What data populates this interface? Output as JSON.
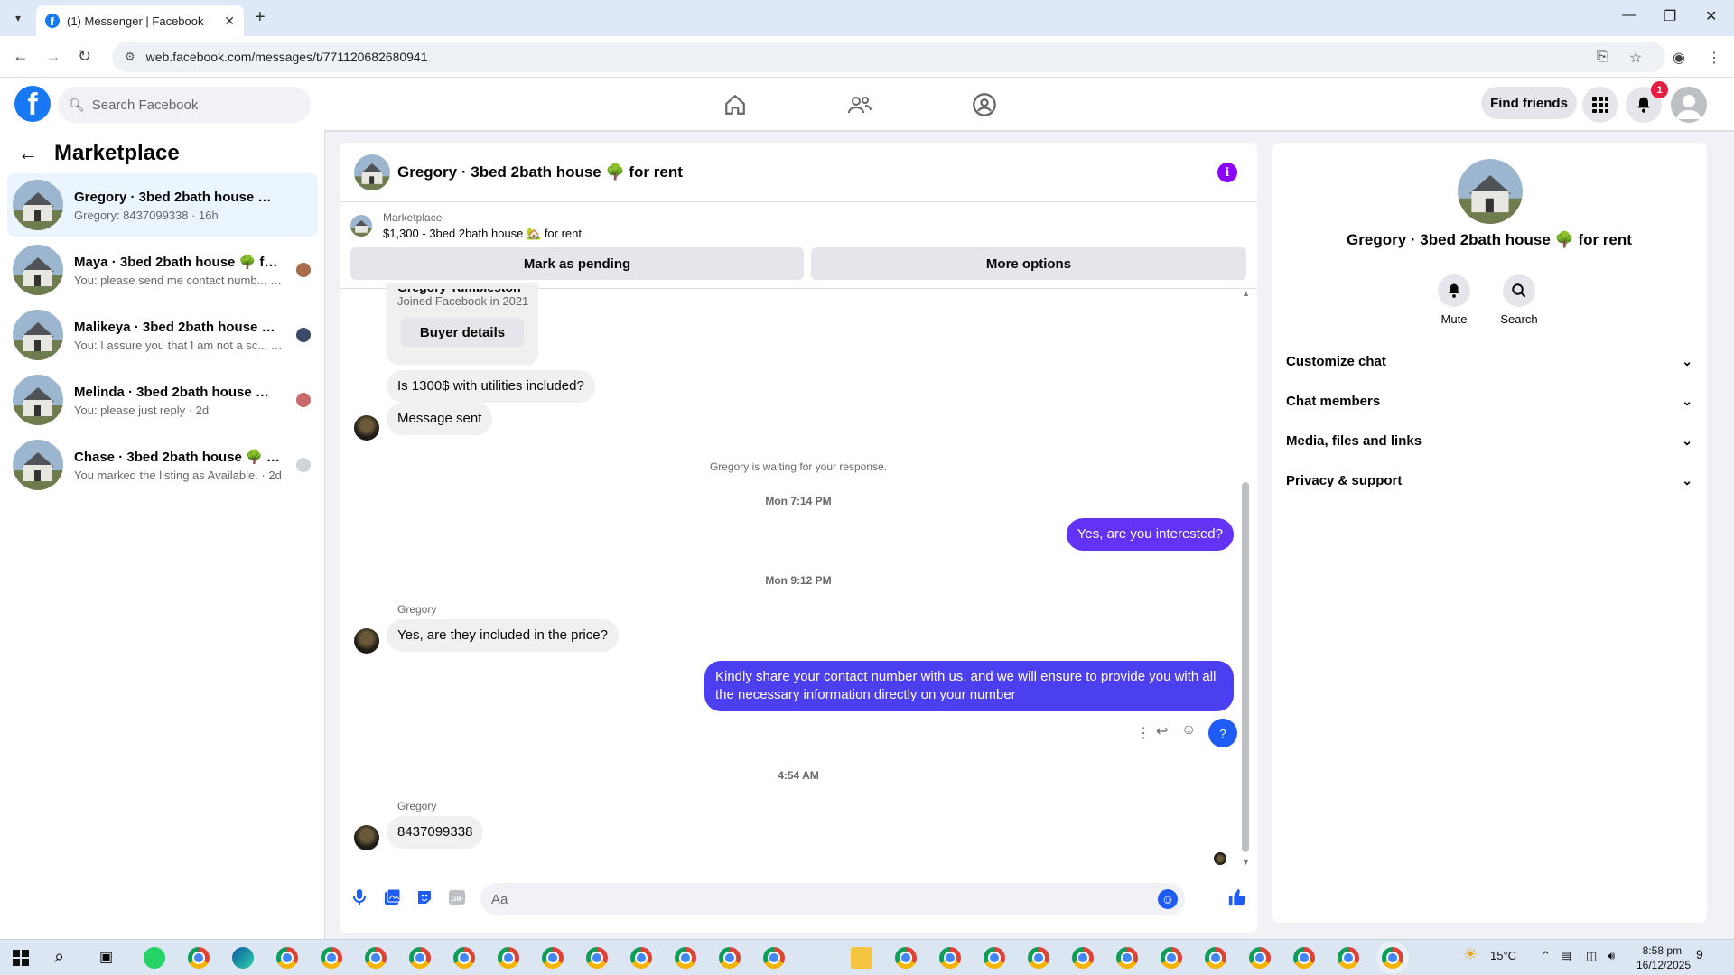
{
  "browser": {
    "tab_title": "(1) Messenger | Facebook",
    "url": "web.facebook.com/messages/t/771120682680941"
  },
  "header": {
    "search_placeholder": "Search Facebook",
    "find_friends": "Find friends",
    "notification_count": "1"
  },
  "sidebar": {
    "title": "Marketplace",
    "conversations": [
      {
        "name": "Gregory · 3bed 2bath house 🌳 fo...",
        "preview": "Gregory: 8437099338 · 16h",
        "active": true
      },
      {
        "name": "Maya · 3bed 2bath house 🌳 for...",
        "preview": "You: please send me contact numb... · 1d"
      },
      {
        "name": "Malikeya · 3bed 2bath house 🌳 ...",
        "preview": "You: I assure you that I am not a sc... · 1d"
      },
      {
        "name": "Melinda · 3bed 2bath house 🌳 ...",
        "preview": "You: please just reply · 2d"
      },
      {
        "name": "Chase · 3bed 2bath house 🌳 fo...",
        "preview": "You marked the listing as Available. · 2d"
      }
    ]
  },
  "chat": {
    "title": "Gregory · 3bed 2bath house 🌳 for rent",
    "listing_category": "Marketplace",
    "listing_price": "$1,300 - 3bed 2bath house 🏡 for rent",
    "mark_pending": "Mark as pending",
    "more_options": "More options",
    "profile_name_partial": "Gregory Tumbleston",
    "profile_joined": "Joined Facebook in 2021",
    "buyer_details": "Buyer details",
    "msg1": "Is 1300$ with utilities included?",
    "msg2": "Message sent",
    "waiting_note": "Gregory is waiting for your response.",
    "ts1": "Mon 7:14 PM",
    "msg3": "Yes, are you interested?",
    "ts2": "Mon 9:12 PM",
    "sender1": "Gregory",
    "msg4": "Yes, are they included in the price?",
    "msg5": "Kindly share your contact number with us, and we will ensure to provide you with all the necessary information directly on your number",
    "ts3": "4:54 AM",
    "sender2": "Gregory",
    "msg6": "8437099338",
    "composer_placeholder": "Aa"
  },
  "right_panel": {
    "name": "Gregory · 3bed 2bath house 🌳 for rent",
    "mute": "Mute",
    "search": "Search",
    "sections": [
      "Customize chat",
      "Chat members",
      "Media, files and links",
      "Privacy & support"
    ]
  },
  "taskbar": {
    "weather": "15°C",
    "time": "8:58 pm",
    "date": "16/12/2025",
    "notif_count": "9"
  },
  "colors": {
    "fb_blue": "#1877f2",
    "outgoing_bubble": "#6233f5",
    "outgoing_bubble_2": "#4b3ff0",
    "badge_red": "#e41e3f"
  }
}
